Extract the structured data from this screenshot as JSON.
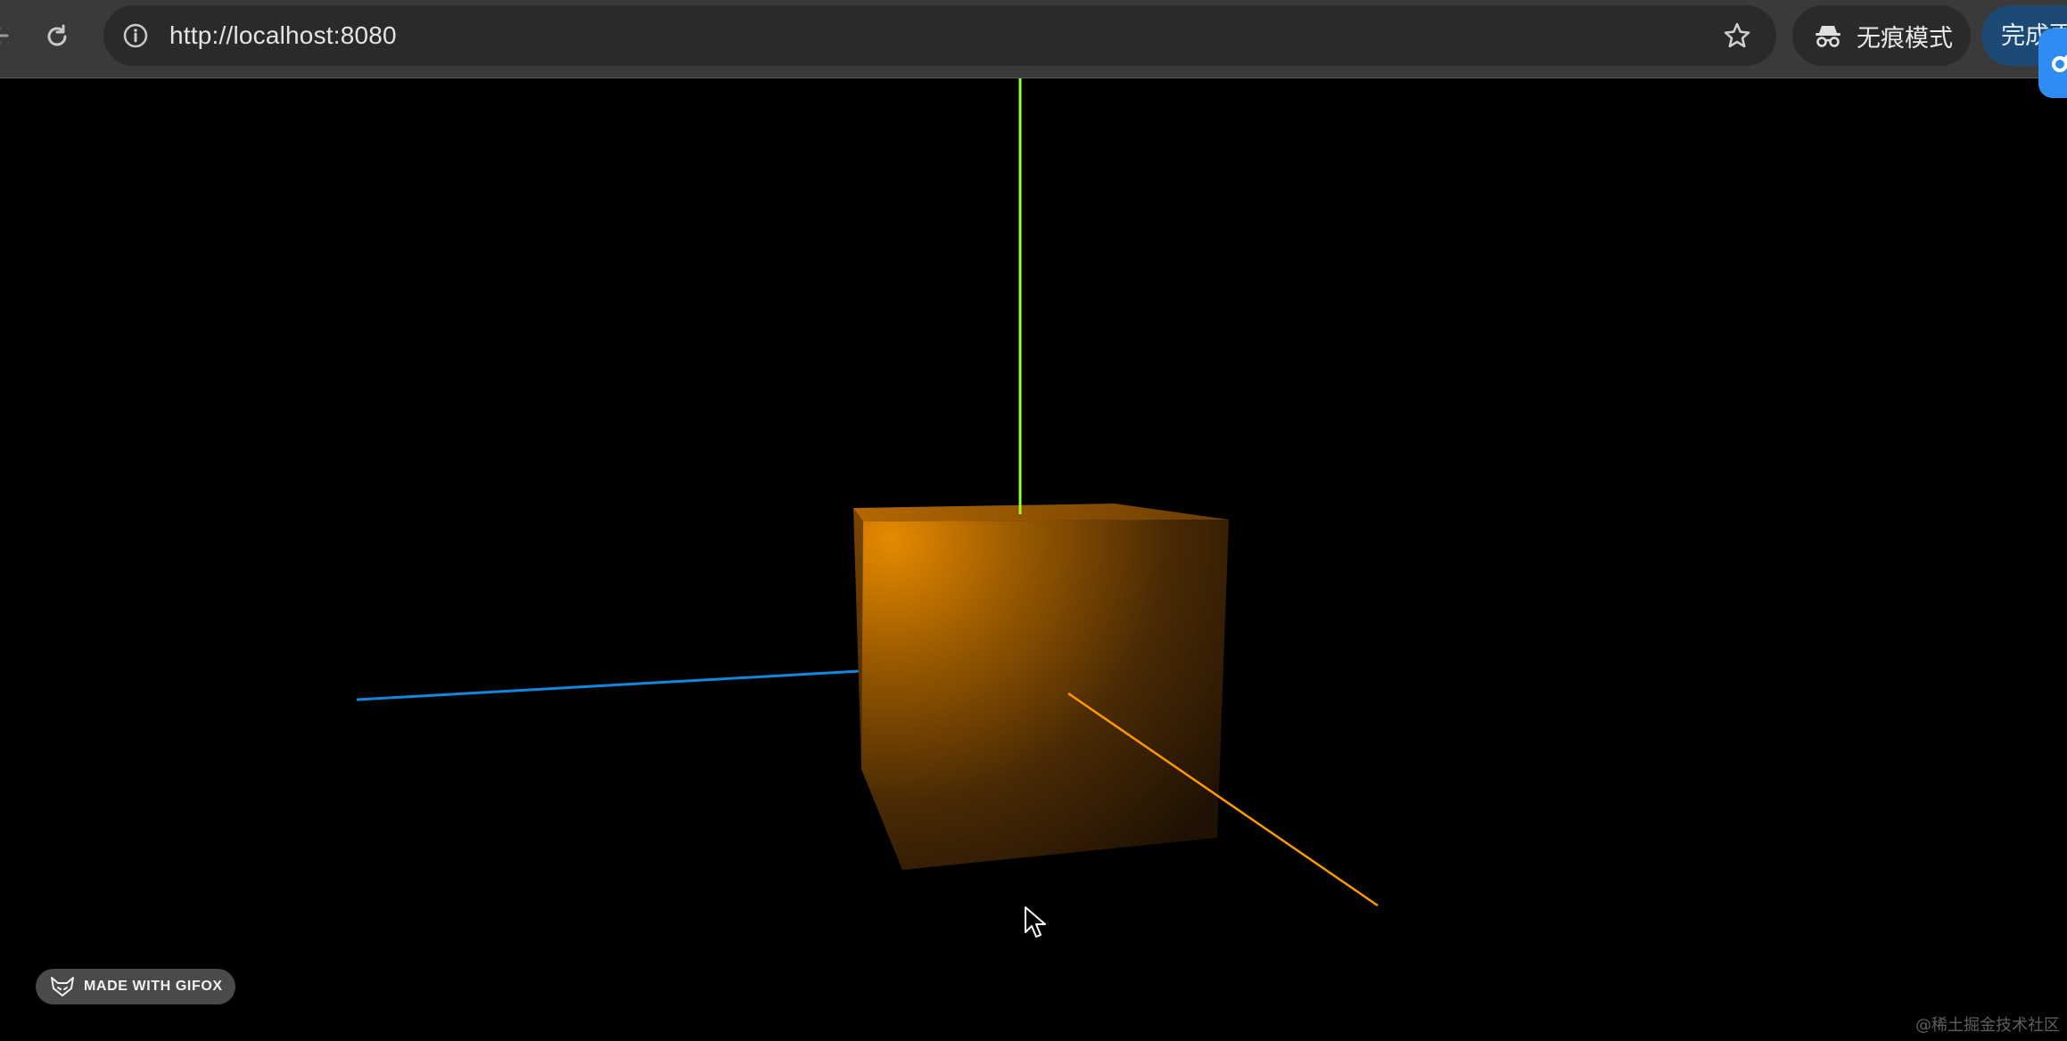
{
  "browser": {
    "url": "http://localhost:8080",
    "incognito_label": "无痕模式",
    "done_label": "完成更",
    "icons": {
      "back": "back-arrow-icon",
      "reload": "reload-icon",
      "site_info": "info-icon",
      "bookmark": "star-icon",
      "incognito": "incognito-icon",
      "side_panel": "link-icon"
    }
  },
  "scene": {
    "background": "#000000",
    "cube_color": "#c77a00",
    "axes": {
      "x_color": "#ff9900",
      "y_color": "#99ff33",
      "z_color": "#1188dd"
    }
  },
  "overlay": {
    "gifox_label": "MADE WITH GIFOX",
    "watermark": "@稀土掘金技术社区"
  }
}
